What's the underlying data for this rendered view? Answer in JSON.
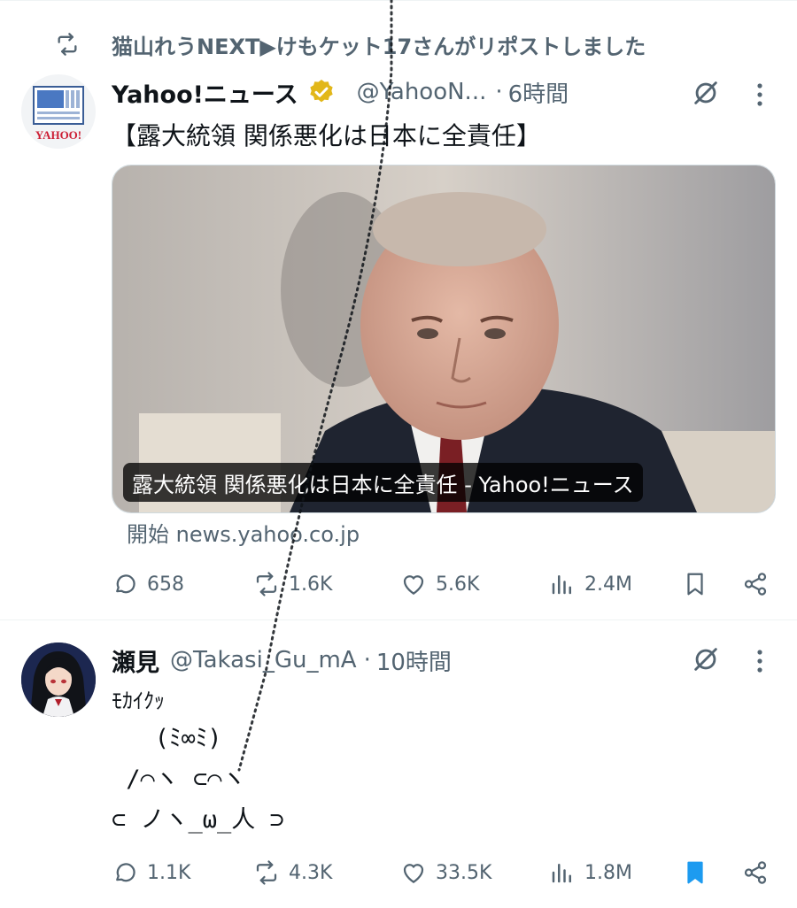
{
  "repost_banner": {
    "text": "猫山れうNEXT▶けもケット17さんがリポストしました"
  },
  "tweets": [
    {
      "author": {
        "name": "Yahoo!ニュース",
        "handle": "@YahooN...",
        "separator": "·",
        "time": "6時間",
        "avatar_logo_text": "YAHOO!"
      },
      "text": "【露大統領 関係悪化は日本に全責任】",
      "media": {
        "caption": "露大統領 関係悪化は日本に全責任 - Yahoo!ニュース"
      },
      "link_source": "開始 news.yahoo.co.jp",
      "metrics": {
        "replies": "658",
        "reposts": "1.6K",
        "likes": "5.6K",
        "views": "2.4M"
      },
      "bookmarked": false
    },
    {
      "author": {
        "name": "瀬見",
        "handle": "@Takasi_Gu_mA",
        "separator": "·",
        "time": "10時間"
      },
      "text": "ﾓｶｲｸｯ",
      "ascii_art": [
        "   (ﾐ∞ﾐ)",
        " /⌒ヽ ⊂⌒ヽ",
        "⊂ ノヽ_ω_人 ⊃"
      ],
      "metrics": {
        "replies": "1.1K",
        "reposts": "4.3K",
        "likes": "33.5K",
        "views": "1.8M"
      },
      "bookmarked": true
    }
  ],
  "colors": {
    "text": "#0f1419",
    "secondary": "#536471",
    "accent": "#1d9bf0",
    "verified_gold": "#e2b719",
    "divider": "#eff3f4"
  },
  "icons": [
    "repost-icon",
    "verified-badge-icon",
    "grok-icon",
    "more-icon",
    "reply-icon",
    "like-icon",
    "views-icon",
    "bookmark-icon",
    "share-icon"
  ]
}
